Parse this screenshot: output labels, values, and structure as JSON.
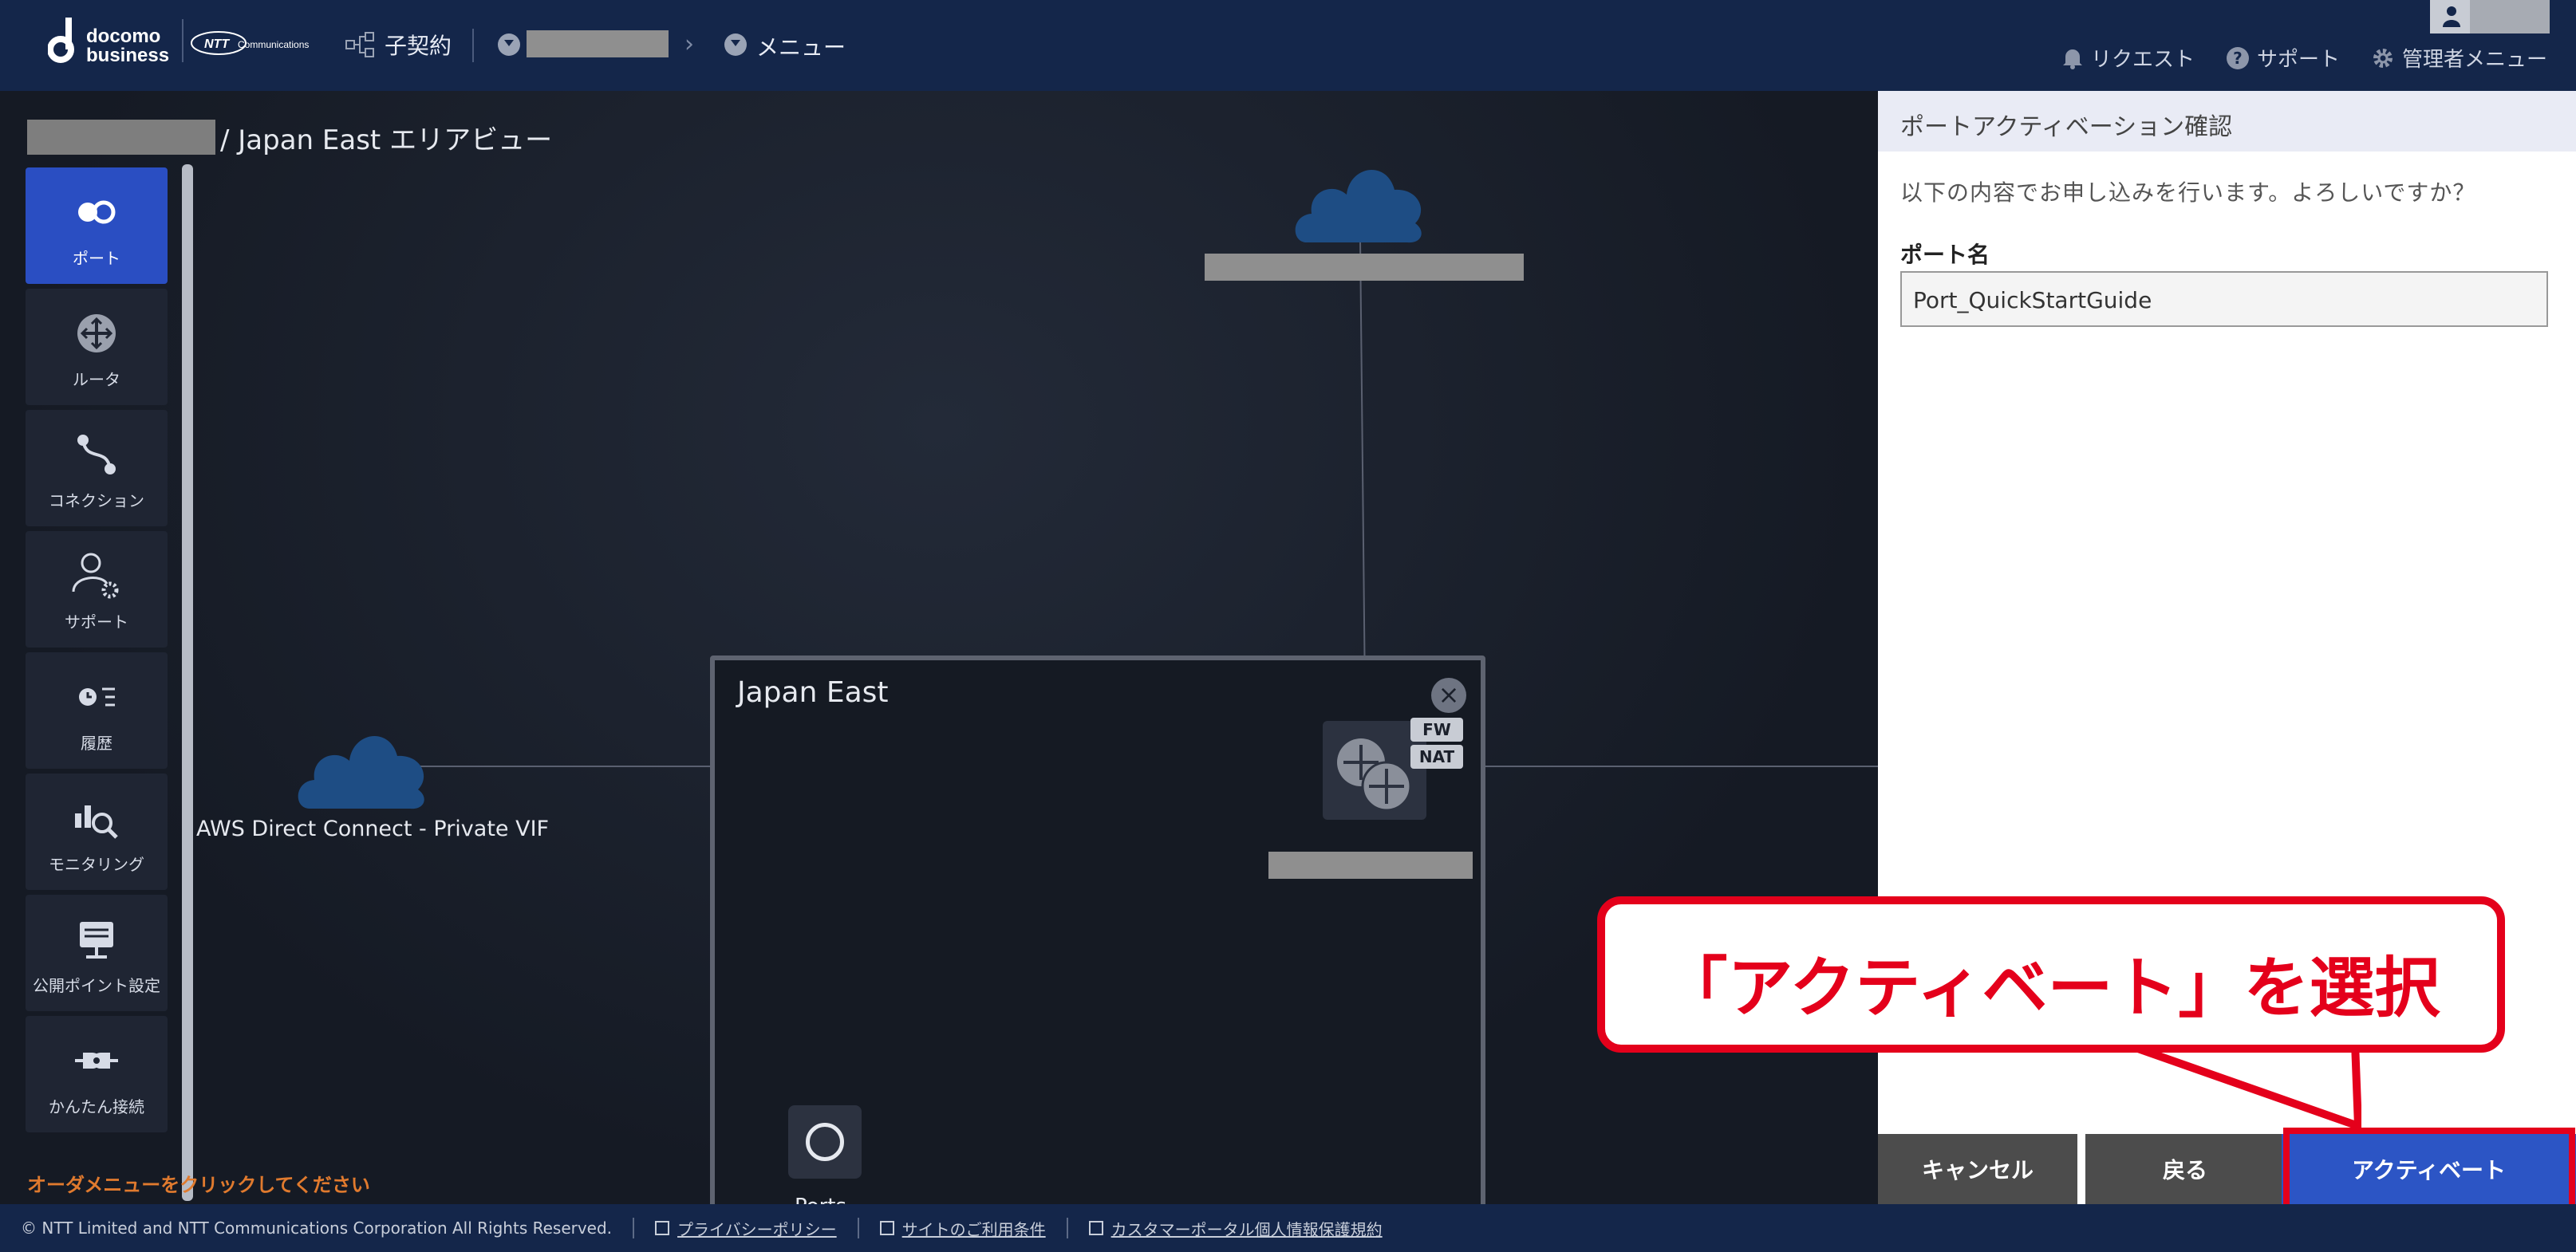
{
  "header": {
    "logo_text": "docomo\nbusiness",
    "ntt_logo_text": "NTT Communications",
    "contract_label": "子契約",
    "menu_label": "メニュー",
    "links": [
      {
        "label": "リクエスト",
        "icon": "bell-icon"
      },
      {
        "label": "サポート",
        "icon": "question-icon"
      },
      {
        "label": "管理者メニュー",
        "icon": "gear-icon"
      }
    ]
  },
  "area": {
    "title_suffix": "/ Japan East エリアビュー"
  },
  "sidebar": {
    "items": [
      {
        "label": "ポート",
        "icon": "port-icon",
        "active": true
      },
      {
        "label": "ルータ",
        "icon": "router-icon",
        "active": false
      },
      {
        "label": "コネクション",
        "icon": "connection-icon",
        "active": false
      },
      {
        "label": "サポート",
        "icon": "support-user-icon",
        "active": false
      },
      {
        "label": "履歴",
        "icon": "history-icon",
        "active": false
      },
      {
        "label": "モニタリング",
        "icon": "monitoring-icon",
        "active": false
      },
      {
        "label": "公開ポイント設定",
        "icon": "public-point-icon",
        "active": false
      },
      {
        "label": "かんたん接続",
        "icon": "easy-connect-icon",
        "active": false
      }
    ]
  },
  "order_message": "オーダメニューをクリックしてください",
  "diagram": {
    "aws_label": "AWS Direct Connect - Private VIF",
    "region_title": "Japan East",
    "tags": [
      "FW",
      "NAT"
    ],
    "ports_label": "Ports"
  },
  "panel": {
    "title": "ポートアクティベーション確認",
    "message": "以下の内容でお申し込みを行います。よろしいですか？",
    "field_label": "ポート名",
    "field_value": "Port_QuickStartGuide",
    "buttons": {
      "cancel": "キャンセル",
      "back": "戻る",
      "activate": "アクティベート"
    }
  },
  "callout": {
    "text": "「アクティベート」を選択"
  },
  "footer": {
    "copyright": "© NTT Limited and NTT Communications Corporation All Rights Reserved.",
    "links": [
      "プライバシーポリシー",
      "サイトのご利用条件",
      "カスタマーポータル個人情報保護規約"
    ]
  },
  "colors": {
    "header_bg": "#14264a",
    "accent_blue": "#2c55c5",
    "callout_red": "#e4001b",
    "order_msg": "#e07a2e"
  }
}
